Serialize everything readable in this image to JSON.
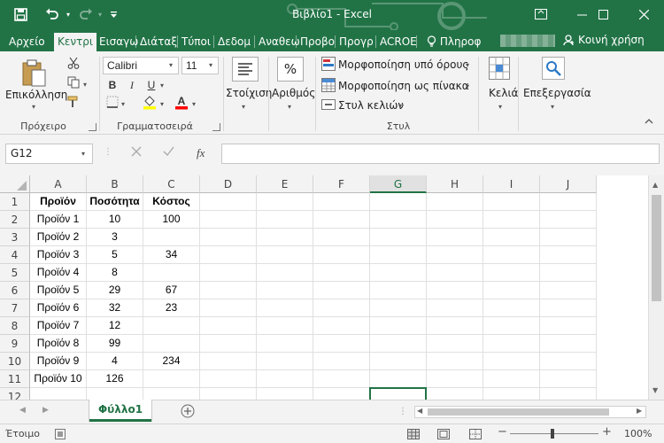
{
  "window": {
    "title": "Βιβλίο1 - Excel",
    "minimize_icon": "minimize-icon",
    "restore_icon": "restore-icon",
    "close_icon": "close-icon"
  },
  "ribbon_tabs": [
    "Αρχείο",
    "Κεντρι",
    "Εισαγω",
    "Διάταξ",
    "Τύποι",
    "Δεδομ",
    "Αναθεω",
    "Προβο",
    "Προγρ",
    "ACROE"
  ],
  "active_tab_index": 1,
  "tell_me": "Πληροφ",
  "share": "Κοινή χρήση",
  "ribbon": {
    "clipboard": {
      "paste": "Επικόλληση",
      "group": "Πρόχειρο"
    },
    "font": {
      "name": "Calibri",
      "size": "11",
      "group": "Γραμματοσειρά",
      "bold": "B",
      "italic": "I",
      "underline": "U"
    },
    "alignment": {
      "label": "Στοίχιση"
    },
    "number": {
      "label": "Αριθμός",
      "symbol": "%"
    },
    "styles": {
      "conditional": "Μορφοποίηση υπό όρους",
      "as_table": "Μορφοποίηση ως πίνακα",
      "cell_styles": "Στυλ κελιών",
      "group": "Στυλ"
    },
    "cells": {
      "label": "Κελιά"
    },
    "editing": {
      "label": "Επεξεργασία"
    }
  },
  "formula_bar": {
    "name_box": "G12",
    "fx": "fx",
    "value": ""
  },
  "sheet": {
    "columns": [
      "A",
      "B",
      "C",
      "D",
      "E",
      "F",
      "G",
      "H",
      "I",
      "J"
    ],
    "selected_column": "G",
    "selected_cell": "G12",
    "rows": [
      [
        "Προϊόν",
        "Ποσότητα",
        "Κόστος"
      ],
      [
        "Προϊόν 1",
        "10",
        "100"
      ],
      [
        "Προϊόν 2",
        "3",
        ""
      ],
      [
        "Προϊόν 3",
        "5",
        "34"
      ],
      [
        "Προϊόν 4",
        "8",
        ""
      ],
      [
        "Προϊόν 5",
        "29",
        "67"
      ],
      [
        "Προϊόν 6",
        "32",
        "23"
      ],
      [
        "Προϊόν 7",
        "12",
        ""
      ],
      [
        "Προϊόν 8",
        "99",
        ""
      ],
      [
        "Προϊόν 9",
        "4",
        "234"
      ],
      [
        "Προϊόν 10",
        "126",
        ""
      ],
      [
        "",
        "",
        ""
      ]
    ]
  },
  "sheet_tabs": [
    "Φύλλο1"
  ],
  "status": {
    "ready": "Έτοιμο",
    "zoom": "100%"
  },
  "colors": {
    "brand": "#217346"
  }
}
